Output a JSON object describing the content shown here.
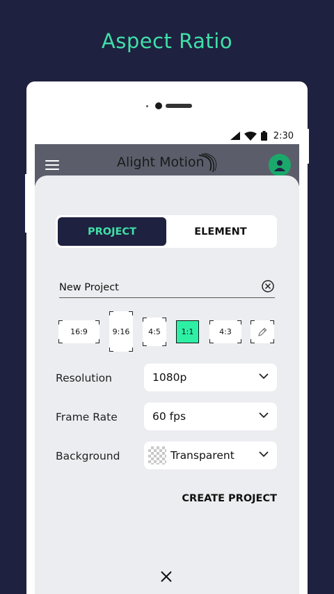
{
  "promo": {
    "title": "Aspect Ratio"
  },
  "status_bar": {
    "time": "2:30"
  },
  "app_bar": {
    "title": "Alight Motion"
  },
  "tabs": [
    {
      "label": "PROJECT",
      "active": true
    },
    {
      "label": "ELEMENT",
      "active": false
    }
  ],
  "project_name": {
    "value": "New Project"
  },
  "aspect_ratios": [
    {
      "label": "16:9",
      "selected": false
    },
    {
      "label": "9:16",
      "selected": false
    },
    {
      "label": "4:5",
      "selected": false
    },
    {
      "label": "1:1",
      "selected": true
    },
    {
      "label": "4:3",
      "selected": false
    },
    {
      "label": "",
      "icon": "pencil-icon",
      "selected": false
    }
  ],
  "settings": {
    "resolution": {
      "label": "Resolution",
      "value": "1080p"
    },
    "frame_rate": {
      "label": "Frame Rate",
      "value": "60 fps"
    },
    "background": {
      "label": "Background",
      "value": "Transparent"
    }
  },
  "actions": {
    "create_label": "CREATE PROJECT"
  },
  "colors": {
    "accent": "#3fe0a8",
    "selected_ratio": "#2ef0a5",
    "dark": "#1f2140"
  }
}
